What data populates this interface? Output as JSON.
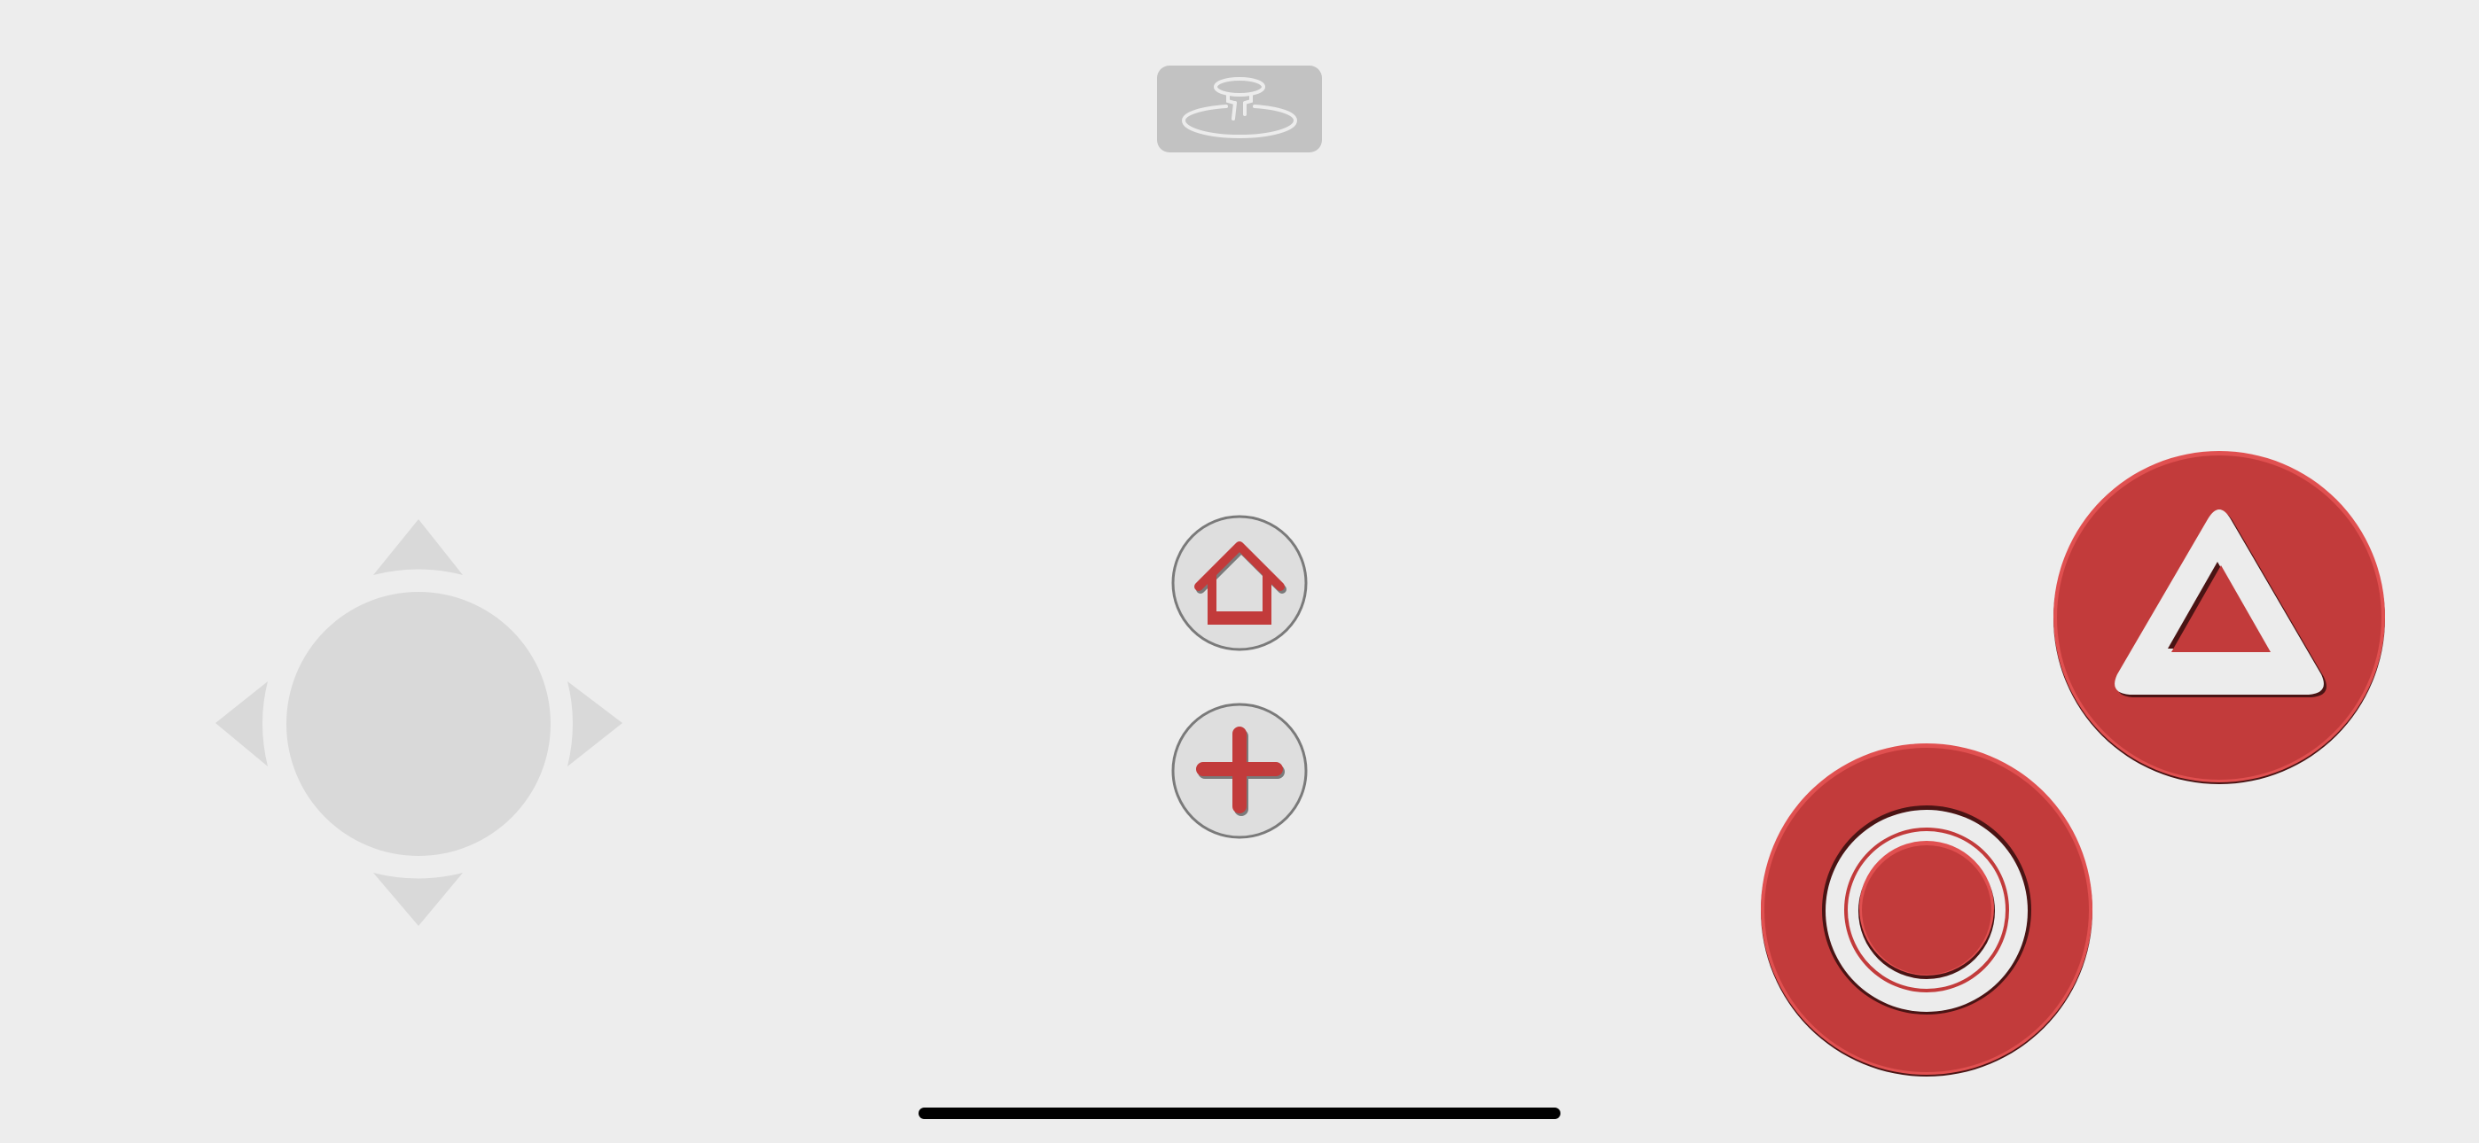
{
  "theme": {
    "background": "#ededed",
    "dpad_color": "#d9d9d9",
    "accent": "#c23b3b",
    "accent_highlight": "#e05050",
    "accent_shadow": "#4a1414",
    "icon_light": "#ececec",
    "small_button_face": "#dedede",
    "small_button_ring": "#7a7a7a",
    "toggle_bg": "#c2c2c2",
    "home_indicator": "#000000"
  },
  "top_toggle": {
    "icon": "joystick-icon",
    "state": "inactive"
  },
  "dpad": {
    "directions": [
      "up",
      "down",
      "left",
      "right"
    ],
    "icons": [
      "arrow-up-icon",
      "arrow-down-icon",
      "arrow-left-icon",
      "arrow-right-icon"
    ]
  },
  "center_buttons": [
    {
      "id": "home",
      "icon": "home-icon"
    },
    {
      "id": "plus",
      "icon": "plus-icon"
    }
  ],
  "action_buttons": [
    {
      "id": "triangle",
      "icon": "triangle-icon"
    },
    {
      "id": "circle",
      "icon": "circle-icon"
    }
  ]
}
